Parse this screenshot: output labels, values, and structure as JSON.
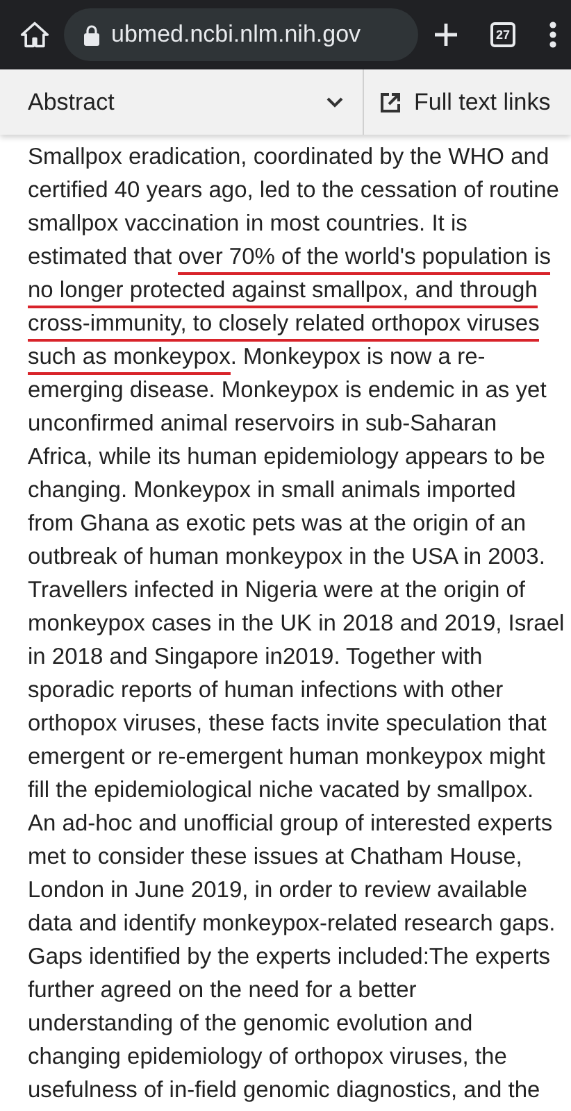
{
  "browser_bar": {
    "url": "ubmed.ncbi.nlm.nih.gov",
    "tab_count": "27"
  },
  "toolbar": {
    "section_dropdown": "Abstract",
    "full_text_link": "Full text links"
  },
  "abstract_lines": [
    [
      {
        "text": "Smallpox eradication, coordinated by the WHO and",
        "underlined": false
      }
    ],
    [
      {
        "text": "certified 40 years ago, led to the cessation of routine",
        "underlined": false
      }
    ],
    [
      {
        "text": "smallpox vaccination in most countries. It is",
        "underlined": false
      }
    ],
    [
      {
        "text": "estimated that ",
        "underlined": false
      },
      {
        "text": "over 70% of the world's population is",
        "underlined": true
      }
    ],
    [
      {
        "text": "no longer protected against smallpox, and through",
        "underlined": true
      }
    ],
    [
      {
        "text": "cross-immunity, to closely related orthopox viruses",
        "underlined": true
      }
    ],
    [
      {
        "text": "such as monkeypox",
        "underlined": true
      },
      {
        "text": ". Monkeypox is now a re-",
        "underlined": false
      }
    ],
    [
      {
        "text": "emerging disease. Monkeypox is endemic in as yet",
        "underlined": false
      }
    ],
    [
      {
        "text": "unconfirmed animal reservoirs in sub-Saharan",
        "underlined": false
      }
    ],
    [
      {
        "text": "Africa, while its human epidemiology appears to be",
        "underlined": false
      }
    ],
    [
      {
        "text": "changing. Monkeypox in small animals imported",
        "underlined": false
      }
    ],
    [
      {
        "text": "from Ghana as exotic pets was at the origin of an",
        "underlined": false
      }
    ],
    [
      {
        "text": "outbreak of human monkeypox in the USA in 2003.",
        "underlined": false
      }
    ],
    [
      {
        "text": "Travellers infected in Nigeria were at the origin of",
        "underlined": false
      }
    ],
    [
      {
        "text": "monkeypox cases in the UK in 2018 and 2019, Israel",
        "underlined": false
      }
    ],
    [
      {
        "text": "in 2018 and Singapore in2019. Together with",
        "underlined": false
      }
    ],
    [
      {
        "text": "sporadic reports of human infections with other",
        "underlined": false
      }
    ],
    [
      {
        "text": "orthopox viruses, these facts invite speculation that",
        "underlined": false
      }
    ],
    [
      {
        "text": "emergent or re-emergent human monkeypox might",
        "underlined": false
      }
    ],
    [
      {
        "text": "fill the epidemiological niche vacated by smallpox.",
        "underlined": false
      }
    ],
    [
      {
        "text": "An ad-hoc and unofficial group of interested experts",
        "underlined": false
      }
    ],
    [
      {
        "text": "met to consider these issues at Chatham House,",
        "underlined": false
      }
    ],
    [
      {
        "text": "London in June 2019, in order to review available",
        "underlined": false
      }
    ],
    [
      {
        "text": "data and identify monkeypox-related research gaps.",
        "underlined": false
      }
    ],
    [
      {
        "text": "Gaps identified by the experts included:The experts",
        "underlined": false
      }
    ],
    [
      {
        "text": "further agreed on the need for a better",
        "underlined": false
      }
    ],
    [
      {
        "text": "understanding of the genomic evolution and",
        "underlined": false
      }
    ],
    [
      {
        "text": "changing epidemiology of orthopox viruses, the",
        "underlined": false
      }
    ],
    [
      {
        "text": "usefulness of in-field genomic diagnostics, and the",
        "underlined": false
      }
    ]
  ]
}
